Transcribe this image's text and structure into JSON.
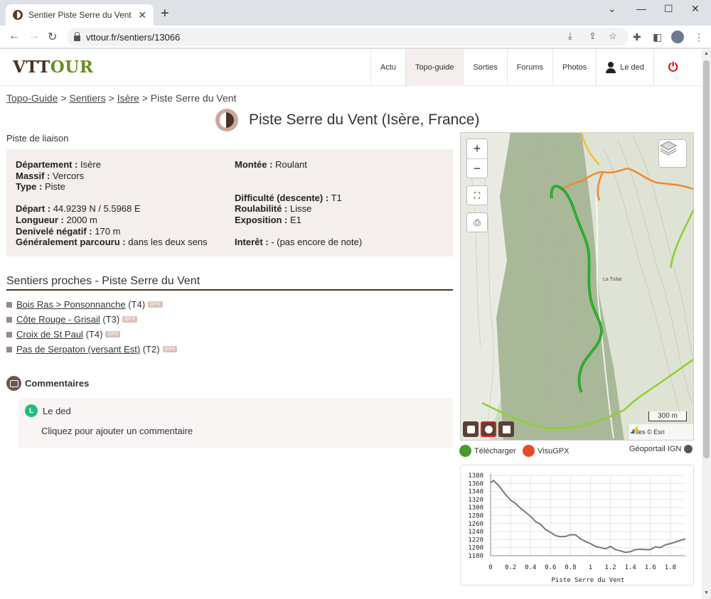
{
  "browser": {
    "tab_title": "Sentier Piste Serre du Vent à VTT",
    "url": "vttour.fr/sentiers/13066"
  },
  "header": {
    "logo_part1": "VTT",
    "logo_part2": "OUR",
    "menu": [
      {
        "label": "Actu"
      },
      {
        "label": "Topo-guide"
      },
      {
        "label": "Sorties"
      },
      {
        "label": "Forums"
      },
      {
        "label": "Photos"
      },
      {
        "label": "Le ded"
      }
    ]
  },
  "breadcrumb": {
    "items": [
      "Topo-Guide",
      "Sentiers",
      "Isère"
    ],
    "separator": ">",
    "current": "Piste Serre du Vent"
  },
  "page": {
    "title": "Piste Serre du Vent (Isère, France)",
    "kind": "Piste de liaison"
  },
  "info": {
    "departement_label": "Département :",
    "departement": "Isère",
    "massif_label": "Massif :",
    "massif": "Vercors",
    "type_label": "Type :",
    "type": "Piste",
    "depart_label": "Départ :",
    "depart": "44.9239 N / 5.5968 E",
    "longueur_label": "Longueur :",
    "longueur": "2000 m",
    "denivele_label": "Denivelé négatif :",
    "denivele": "170 m",
    "parcouru_label": "Généralement parcouru :",
    "parcouru": "dans les deux sens",
    "montee_label": "Montée :",
    "montee": "Roulant",
    "difficulte_label": "Difficulté (descente) :",
    "difficulte": "T1",
    "roulabilite_label": "Roulabilité :",
    "roulabilite": "Lisse",
    "exposition_label": "Exposition :",
    "exposition": "E1",
    "interet_label": "Interêt :",
    "interet": "- (pas encore de note)"
  },
  "nearby": {
    "heading": "Sentiers proches - Piste Serre du Vent",
    "gpx_label": "GPX",
    "items": [
      {
        "name": "Bois Ras > Ponsonnanche",
        "grade": "(T4)"
      },
      {
        "name": "Côte Rouge - Grisail",
        "grade": "(T3)"
      },
      {
        "name": "Croix de St Paul",
        "grade": "(T4)"
      },
      {
        "name": "Pas de Serpaton (versant Est)",
        "grade": "(T2)"
      }
    ]
  },
  "comments": {
    "heading": "Commentaires",
    "user_initial": "L",
    "user_name": "Le ded",
    "prompt": "Cliquez pour ajouter un commentaire"
  },
  "map": {
    "zoom_in": "+",
    "zoom_out": "−",
    "scale": "300 m",
    "attribution": "Tiles © Esri",
    "place_label": "La Tuilat"
  },
  "map_tools": {
    "download": "Télécharger",
    "visugpx": "VisuGPX",
    "geoportail": "Géoportail IGN"
  },
  "chart_data": {
    "type": "line",
    "title": "",
    "xlabel": "Piste Serre du Vent",
    "ylabel": "",
    "xlim": [
      0,
      1.95
    ],
    "ylim": [
      1180,
      1380
    ],
    "xticks": [
      0,
      0.2,
      0.4,
      0.6,
      0.8,
      1,
      1.2,
      1.4,
      1.6,
      1.8
    ],
    "yticks": [
      1180,
      1200,
      1220,
      1240,
      1260,
      1280,
      1300,
      1320,
      1340,
      1360,
      1380
    ],
    "grid": true,
    "series": [
      {
        "name": "",
        "color": "#777777",
        "x": [
          0,
          0.03,
          0.08,
          0.15,
          0.2,
          0.25,
          0.3,
          0.35,
          0.4,
          0.45,
          0.5,
          0.55,
          0.6,
          0.65,
          0.7,
          0.75,
          0.8,
          0.85,
          0.9,
          0.95,
          1.0,
          1.05,
          1.1,
          1.15,
          1.2,
          1.25,
          1.3,
          1.35,
          1.4,
          1.45,
          1.5,
          1.55,
          1.6,
          1.65,
          1.7,
          1.75,
          1.8,
          1.85,
          1.9,
          1.95
        ],
        "y": [
          1362,
          1367,
          1355,
          1332,
          1318,
          1310,
          1298,
          1288,
          1278,
          1265,
          1258,
          1245,
          1238,
          1230,
          1227,
          1228,
          1232,
          1232,
          1222,
          1215,
          1210,
          1203,
          1200,
          1197,
          1203,
          1195,
          1192,
          1188,
          1190,
          1195,
          1196,
          1195,
          1195,
          1202,
          1200,
          1207,
          1210,
          1214,
          1218,
          1222
        ]
      }
    ]
  },
  "colors": {
    "brand_dark": "#4a3222",
    "brand_green": "#6b8e23",
    "panel_bg": "#f4eeec",
    "track": "#1a9a1a",
    "profile_line": "#777777"
  }
}
